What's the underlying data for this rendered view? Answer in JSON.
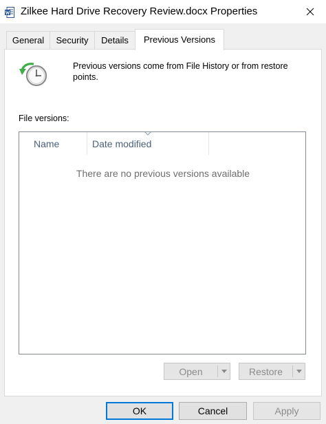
{
  "window": {
    "title": "Zilkee Hard Drive Recovery Review.docx Properties",
    "icon": "word-document-icon",
    "close_icon": "close-icon"
  },
  "tabs": [
    {
      "label": "General",
      "active": false
    },
    {
      "label": "Security",
      "active": false
    },
    {
      "label": "Details",
      "active": false
    },
    {
      "label": "Previous Versions",
      "active": true
    }
  ],
  "previous_versions": {
    "icon": "clock-restore-icon",
    "intro": "Previous versions come from File History or from restore points.",
    "list_label": "File versions:",
    "columns": [
      "Name",
      "Date modified"
    ],
    "sorted_column": "Date modified",
    "empty_message": "There are no previous versions available",
    "open_label": "Open",
    "restore_label": "Restore"
  },
  "footer": {
    "ok_label": "OK",
    "cancel_label": "Cancel",
    "apply_label": "Apply"
  },
  "colors": {
    "accent": "#0078d7",
    "header_text": "#4c607a",
    "disabled_text": "#8b8b8b",
    "clock_arrow": "#3fae49"
  }
}
